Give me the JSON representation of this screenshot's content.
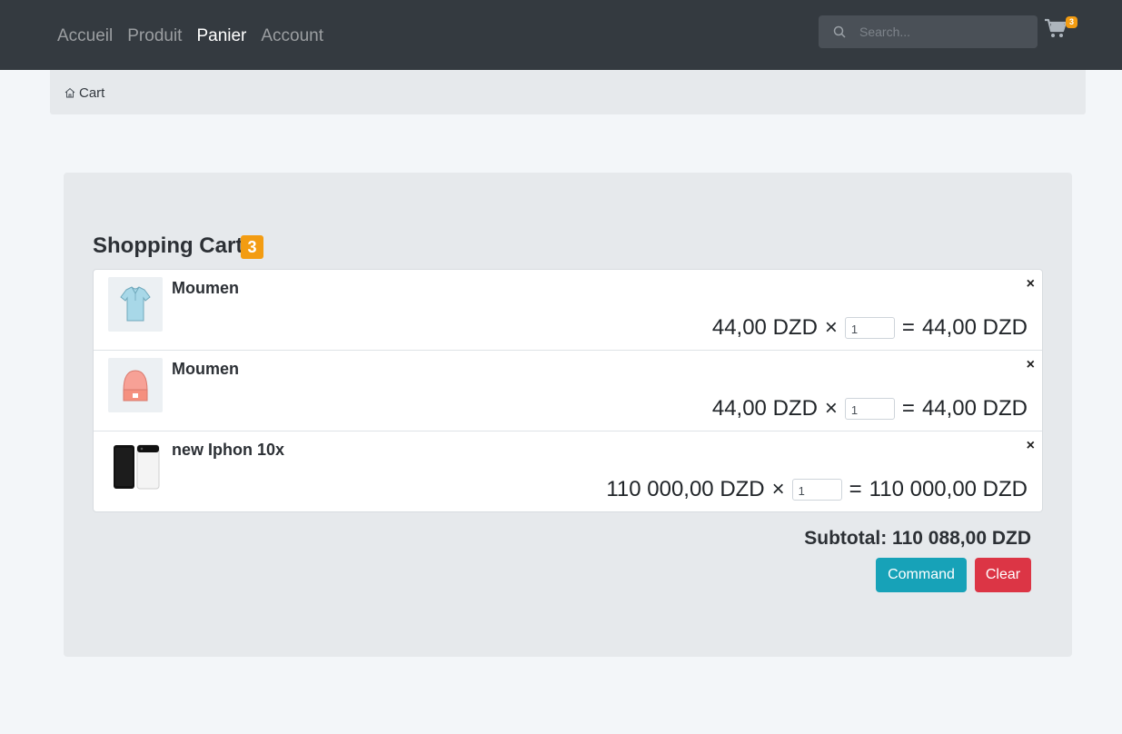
{
  "nav": {
    "links": [
      "Accueil",
      "Produit",
      "Panier",
      "Account"
    ],
    "active_index": 2,
    "search_placeholder": "Search...",
    "cart_count": "3"
  },
  "breadcrumb": {
    "label": "Cart"
  },
  "cart": {
    "title": "Shopping Cart",
    "badge": "3",
    "items": [
      {
        "name": "Moumen",
        "price": "44,00 DZD",
        "times": "×",
        "qty": "1",
        "equals": "=",
        "total": "44,00 DZD",
        "remove": "×",
        "image": "tshirt-image"
      },
      {
        "name": "Moumen",
        "price": "44,00 DZD",
        "times": "×",
        "qty": "1",
        "equals": "=",
        "total": "44,00 DZD",
        "remove": "×",
        "image": "beanie-image"
      },
      {
        "name": "new Iphon 10x",
        "price": "110 000,00 DZD",
        "times": "×",
        "qty": "1",
        "equals": "=",
        "total": "110 000,00 DZD",
        "remove": "×",
        "image": "phone-image"
      }
    ],
    "subtotal": "Subtotal: 110 088,00 DZD",
    "command_label": "Command",
    "clear_label": "Clear"
  },
  "colors": {
    "navbar": "#343a40",
    "badge": "#f39c12",
    "command": "#17a2b8",
    "clear": "#dc3545"
  }
}
